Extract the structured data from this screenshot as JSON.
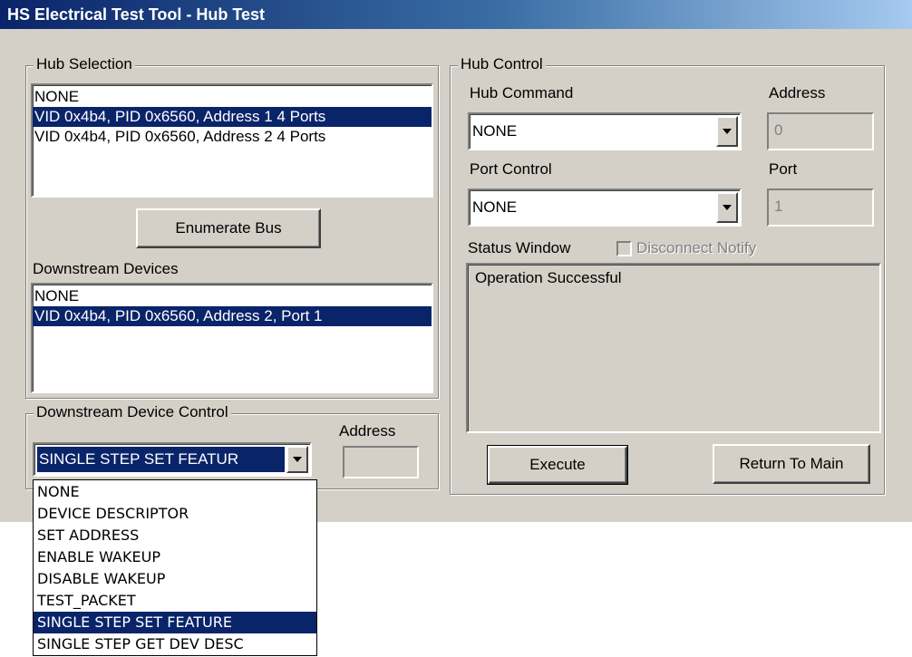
{
  "window": {
    "title": "HS Electrical Test Tool - Hub Test"
  },
  "hub_selection": {
    "group_label": "Hub Selection",
    "items": [
      "NONE",
      "VID 0x4b4, PID 0x6560, Address 1  4 Ports",
      "VID 0x4b4, PID 0x6560, Address 2  4 Ports"
    ],
    "selected_index": 1,
    "enumerate_button": "Enumerate Bus"
  },
  "downstream_devices": {
    "label": "Downstream Devices",
    "items": [
      "NONE",
      "VID 0x4b4, PID 0x6560, Address 2, Port 1"
    ],
    "selected_index": 1
  },
  "downstream_device_control": {
    "group_label": "Downstream Device Control",
    "address_label": "Address",
    "selected_value": "SINGLE STEP SET FEATUR",
    "address_value": "",
    "dropdown_options": [
      "NONE",
      "DEVICE DESCRIPTOR",
      "SET ADDRESS",
      "ENABLE WAKEUP",
      "DISABLE WAKEUP",
      "TEST_PACKET",
      "SINGLE STEP SET FEATURE",
      "SINGLE STEP GET DEV DESC"
    ],
    "dropdown_selected_index": 6
  },
  "hub_control": {
    "group_label": "Hub Control",
    "hub_command_label": "Hub Command",
    "hub_command_value": "NONE",
    "address_label": "Address",
    "address_value": "0",
    "port_control_label": "Port Control",
    "port_control_value": "NONE",
    "port_label": "Port",
    "port_value": "1",
    "status_window_label": "Status Window",
    "disconnect_notify_label": "Disconnect Notify",
    "disconnect_notify_checked": false,
    "status_text": "Operation Successful",
    "execute_button": "Execute",
    "return_button": "Return To Main"
  },
  "icons": {
    "dropdown_arrow": "chevron-down-icon"
  },
  "colors": {
    "window_face": "#d4d0c8",
    "selection": "#0a246a",
    "title_gradient_start": "#0a246a",
    "title_gradient_end": "#a6caf0"
  }
}
